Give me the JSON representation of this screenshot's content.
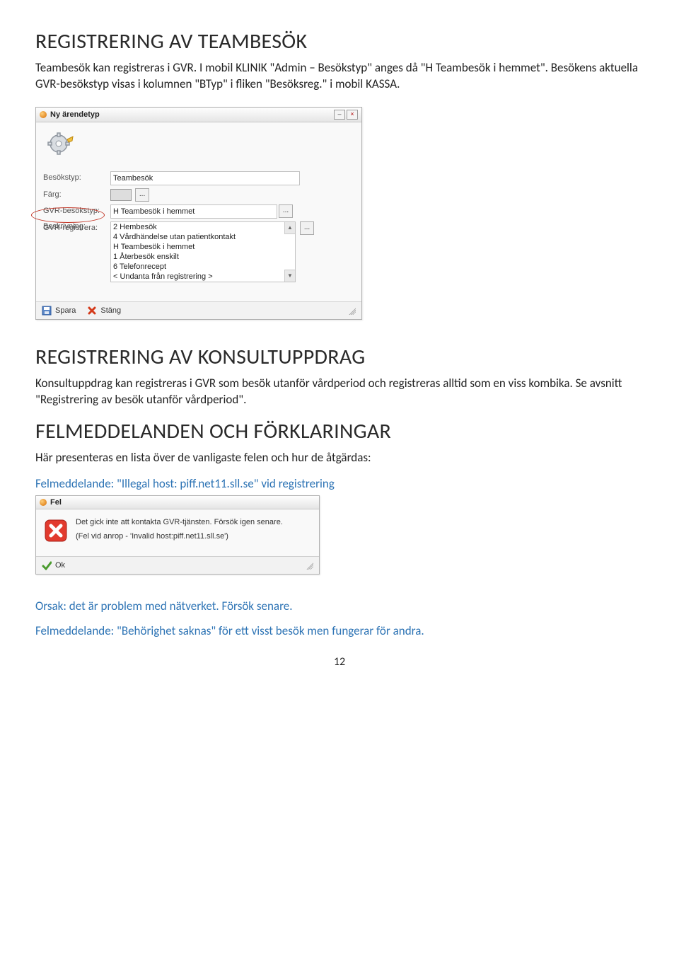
{
  "section1": {
    "heading": "REGISTRERING AV TEAMBESÖK",
    "body": "Teambesök kan registreras i GVR. I mobil KLINIK \"Admin – Besökstyp\" anges då \"H Teambesök i hemmet\". Besökens aktuella GVR-besökstyp visas i kolumnen \"BTyp\" i fliken \"Besöksreg.\" i mobil KASSA."
  },
  "dialog1": {
    "title": "Ny ärendetyp",
    "labels": {
      "besokstyp": "Besökstyp:",
      "farg": "Färg:",
      "gvr_besokstyp": "GVR-besökstyp:",
      "gvr_registrera": "GVR-registrera:",
      "beskrivning": "Beskrivning:"
    },
    "values": {
      "besokstyp": "Teambesök",
      "gvr_sel": "H Teambesök i hemmet"
    },
    "dropdown": [
      "2 Hembesök",
      "4 Vårdhändelse utan patientkontakt",
      "H Teambesök i hemmet",
      "1 Återbesök enskilt",
      "6 Telefonrecept",
      "< Undanta från registrering >"
    ],
    "footer": {
      "save": "Spara",
      "close": "Stäng"
    }
  },
  "section2": {
    "heading": "REGISTRERING AV KONSULTUPPDRAG",
    "body": "Konsultuppdrag kan registreras i GVR som besök utanför vårdperiod och registreras alltid som en viss kombika. Se avsnitt \"Registrering av besök utanför vårdperiod\"."
  },
  "section3": {
    "heading": "FELMEDDELANDEN OCH FÖRKLARINGAR",
    "intro": "Här presenteras en lista över de vanligaste felen och hur de åtgärdas:",
    "err1_title": "Felmeddelande: \"Illegal host: piff.net11.sll.se\" vid registrering"
  },
  "dialog2": {
    "title": "Fel",
    "line1": "Det gick inte att kontakta GVR-tjänsten. Försök igen senare.",
    "line2": "(Fel vid anrop - 'Invalid host:piff.net11.sll.se')",
    "ok": "Ok"
  },
  "section3b": {
    "cause": "Orsak: det är problem med nätverket. Försök senare.",
    "err2_title": "Felmeddelande: \"Behörighet saknas\" för ett visst besök men fungerar för andra."
  },
  "pagenum": "12"
}
